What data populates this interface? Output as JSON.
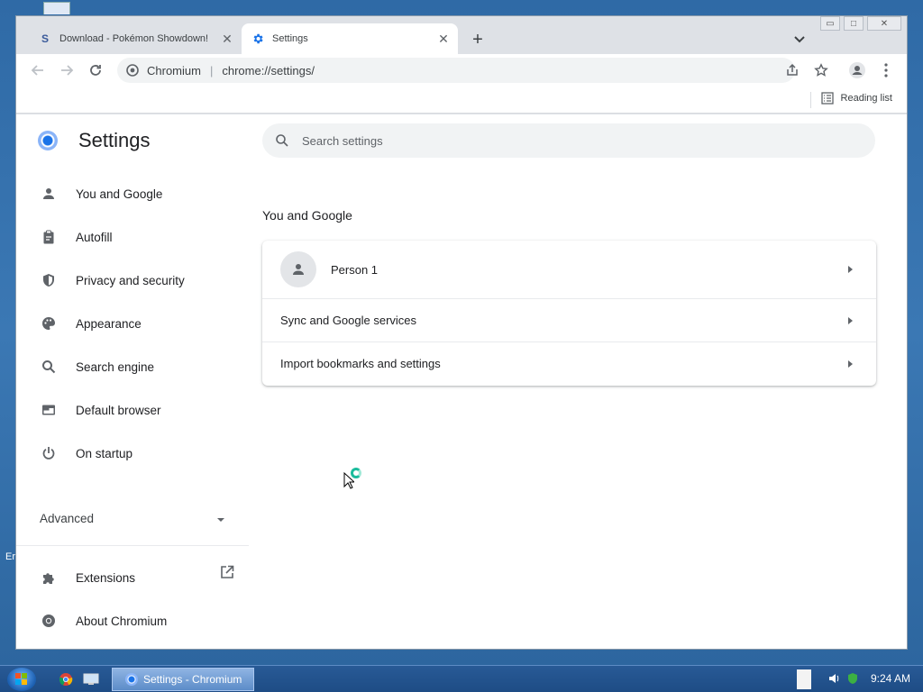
{
  "desktop": {
    "side_text": "Er"
  },
  "tabs": [
    {
      "title": "Download - Pokémon Showdown!",
      "favicon": "S"
    },
    {
      "title": "Settings"
    }
  ],
  "toolbar": {
    "origin": "Chromium",
    "url": "chrome://settings/"
  },
  "bookmarks": {
    "reading_list": "Reading list"
  },
  "sidebar": {
    "title": "Settings",
    "items": [
      {
        "label": "You and Google",
        "icon": "person-icon"
      },
      {
        "label": "Autofill",
        "icon": "clipboard-icon"
      },
      {
        "label": "Privacy and security",
        "icon": "shield-icon"
      },
      {
        "label": "Appearance",
        "icon": "palette-icon"
      },
      {
        "label": "Search engine",
        "icon": "search-icon"
      },
      {
        "label": "Default browser",
        "icon": "browser-window-icon"
      },
      {
        "label": "On startup",
        "icon": "power-icon"
      }
    ],
    "advanced": "Advanced",
    "extensions": "Extensions",
    "about": "About Chromium"
  },
  "search": {
    "placeholder": "Search settings"
  },
  "main": {
    "section_title": "You and Google",
    "rows": [
      {
        "label": "Person 1"
      },
      {
        "label": "Sync and Google services"
      },
      {
        "label": "Import bookmarks and settings"
      }
    ]
  },
  "taskbar": {
    "task_label": "Settings - Chromium",
    "clock": "9:24 AM"
  },
  "colors": {
    "accent": "#1a73e8",
    "taskbar": "#1e4c85",
    "desktop": "#3a6ea5"
  }
}
